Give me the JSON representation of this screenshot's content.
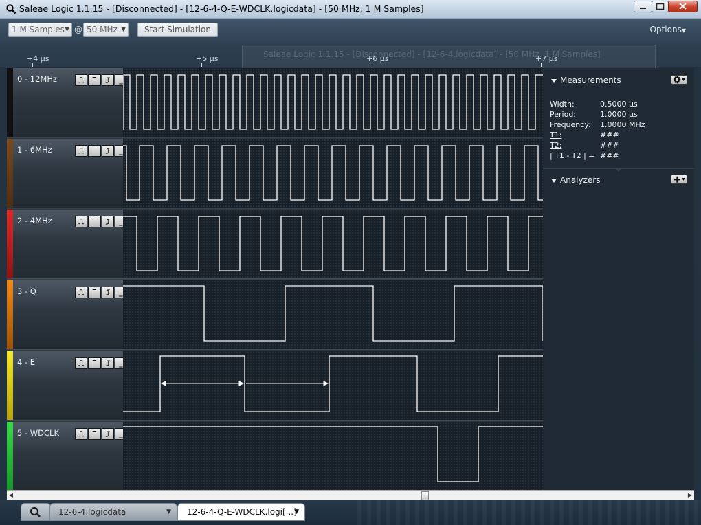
{
  "window": {
    "title": "Saleae Logic 1.1.15 - [Disconnected] - [12-6-4-Q-E-WDCLK.logicdata] - [50 MHz, 1 M Samples]",
    "background_window_title": "Saleae Logic 1.1.15 - [Disconnected] - [12-6-4.logicdata] - [50 MHz, 1 M Samples]"
  },
  "toolbar": {
    "samples": "1 M Samples",
    "at": "@",
    "rate": "50 MHz",
    "start_simulation": "Start Simulation",
    "options": "Options"
  },
  "timeline": {
    "ticks": [
      "+4 µs",
      "+5 µs",
      "+6 µs",
      "+7 µs"
    ]
  },
  "channels": [
    {
      "name": "0 - 12MHz",
      "color": "#111111",
      "trigger_icons": [
        "rising-edge",
        "high",
        "falling-edge",
        "low"
      ]
    },
    {
      "name": "1 - 6MHz",
      "color": "#7a4a1c",
      "trigger_icons": [
        "rising-edge",
        "high",
        "falling-edge",
        "low"
      ]
    },
    {
      "name": "2 - 4MHz",
      "color": "#d82424",
      "trigger_icons": [
        "rising-edge",
        "high",
        "falling-edge",
        "low"
      ]
    },
    {
      "name": "3 - Q",
      "color": "#e07a10",
      "trigger_icons": [
        "rising-edge",
        "high",
        "falling-edge",
        "low"
      ]
    },
    {
      "name": "4 - E",
      "color": "#f2e21c",
      "trigger_icons": [
        "rising-edge",
        "high",
        "falling-edge",
        "low"
      ]
    },
    {
      "name": "5 - WDCLK",
      "color": "#2ac33a",
      "trigger_icons": [
        "rising-edge",
        "high",
        "falling-edge",
        "low"
      ]
    }
  ],
  "measurements": {
    "header": "Measurements",
    "rows": [
      {
        "label": "Width:",
        "value": "0.5000 µs"
      },
      {
        "label": "Period:",
        "value": "1.0000 µs"
      },
      {
        "label": "Frequency:",
        "value": "1.0000 MHz"
      },
      {
        "label": "T1:",
        "value": "###"
      },
      {
        "label": "T2:",
        "value": "###"
      },
      {
        "label": "| T1 - T2 | =",
        "value": "###"
      }
    ]
  },
  "analyzers": {
    "header": "Analyzers"
  },
  "tabs": [
    {
      "label": "12-6-4.logicdata"
    },
    {
      "label": "12-6-4-Q-E-WDCLK.logi[...]"
    }
  ],
  "icons": {
    "app": "magnifier-icon",
    "settings": "gear-icon",
    "add": "plus-icon"
  }
}
